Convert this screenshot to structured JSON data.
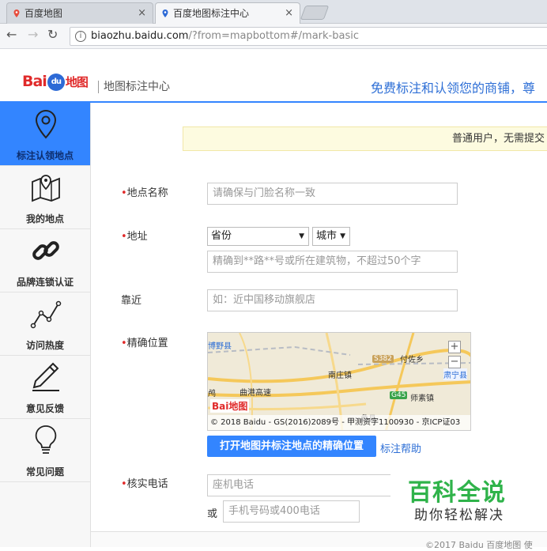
{
  "browser": {
    "tabs": [
      {
        "label": "百度地图"
      },
      {
        "label": "百度地图标注中心"
      }
    ],
    "close_symbol": "×",
    "address_host": "biaozhu.baidu.com",
    "address_path": "/?from=mapbottom#/mark-basic"
  },
  "header": {
    "logo_bai": "Bai",
    "logo_du": "du",
    "logo_map": "地图",
    "subtitle": "地图标注中心",
    "slogan": "免费标注和认领您的商铺，尊"
  },
  "sidebar": {
    "items": [
      {
        "label": "标注认领地点",
        "icon": "location-pin-icon"
      },
      {
        "label": "我的地点",
        "icon": "map-icon"
      },
      {
        "label": "品牌连锁认证",
        "icon": "chain-link-icon"
      },
      {
        "label": "访问热度",
        "icon": "line-chart-icon"
      },
      {
        "label": "意见反馈",
        "icon": "pencil-icon"
      },
      {
        "label": "常见问题",
        "icon": "lightbulb-icon"
      }
    ],
    "accent_color": "#3385ff"
  },
  "notice": "普通用户，无需提交",
  "form": {
    "required_mark": "•",
    "name": {
      "label": "地点名称",
      "placeholder": "请确保与门脸名称一致"
    },
    "address": {
      "label": "地址",
      "province": "省份",
      "city": "城市",
      "detail_placeholder": "精确到**路**号或所在建筑物，不超过50个字"
    },
    "near": {
      "label": "靠近",
      "placeholder": "如：近中国移动旗舰店"
    },
    "location": {
      "label": "精确位置",
      "map_labels": [
        "博野县",
        "南庄镇",
        "曲港高速",
        "付佐乡",
        "师素镇",
        "蠡县",
        "肃宁县",
        "鸬"
      ],
      "road_badges": [
        "S382",
        "G45"
      ],
      "zoom_in": "+",
      "zoom_out": "−",
      "copyright": "© 2018 Baidu - GS(2016)2089号 - 甲测资字1100930 - 京ICP证03",
      "open_button": "打开地图并标注地点的精确位置",
      "help_link": "标注帮助"
    },
    "phone": {
      "label": "核实电话",
      "landline_placeholder": "座机电话",
      "or": "或",
      "mobile_placeholder": "手机号码或400电话"
    }
  },
  "watermark": {
    "title": "百科全说",
    "subtitle": "助你轻松解决"
  },
  "footer": "©2017 Baidu  百度地图  使"
}
